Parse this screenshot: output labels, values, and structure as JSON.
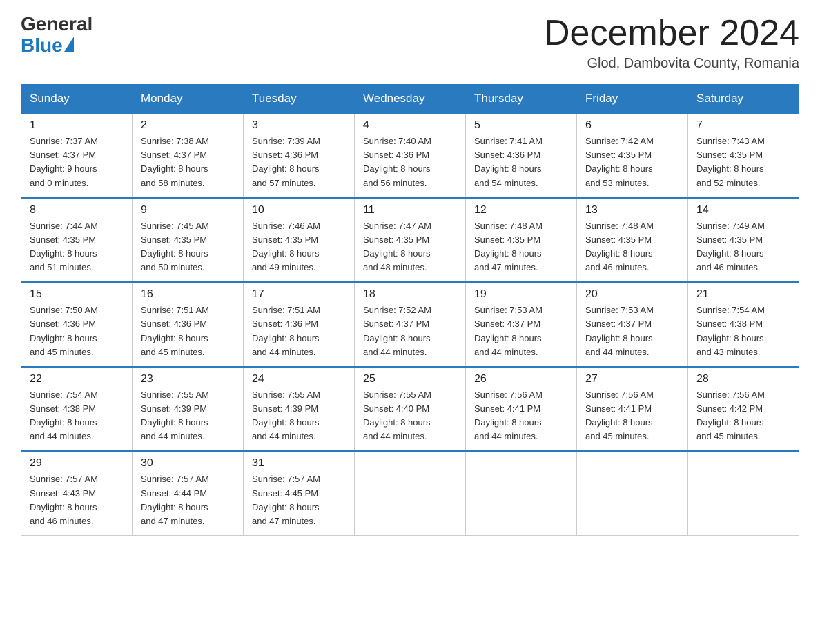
{
  "logo": {
    "general": "General",
    "blue": "Blue"
  },
  "title": "December 2024",
  "location": "Glod, Dambovita County, Romania",
  "days_of_week": [
    "Sunday",
    "Monday",
    "Tuesday",
    "Wednesday",
    "Thursday",
    "Friday",
    "Saturday"
  ],
  "weeks": [
    [
      {
        "day": "1",
        "info": "Sunrise: 7:37 AM\nSunset: 4:37 PM\nDaylight: 9 hours\nand 0 minutes."
      },
      {
        "day": "2",
        "info": "Sunrise: 7:38 AM\nSunset: 4:37 PM\nDaylight: 8 hours\nand 58 minutes."
      },
      {
        "day": "3",
        "info": "Sunrise: 7:39 AM\nSunset: 4:36 PM\nDaylight: 8 hours\nand 57 minutes."
      },
      {
        "day": "4",
        "info": "Sunrise: 7:40 AM\nSunset: 4:36 PM\nDaylight: 8 hours\nand 56 minutes."
      },
      {
        "day": "5",
        "info": "Sunrise: 7:41 AM\nSunset: 4:36 PM\nDaylight: 8 hours\nand 54 minutes."
      },
      {
        "day": "6",
        "info": "Sunrise: 7:42 AM\nSunset: 4:35 PM\nDaylight: 8 hours\nand 53 minutes."
      },
      {
        "day": "7",
        "info": "Sunrise: 7:43 AM\nSunset: 4:35 PM\nDaylight: 8 hours\nand 52 minutes."
      }
    ],
    [
      {
        "day": "8",
        "info": "Sunrise: 7:44 AM\nSunset: 4:35 PM\nDaylight: 8 hours\nand 51 minutes."
      },
      {
        "day": "9",
        "info": "Sunrise: 7:45 AM\nSunset: 4:35 PM\nDaylight: 8 hours\nand 50 minutes."
      },
      {
        "day": "10",
        "info": "Sunrise: 7:46 AM\nSunset: 4:35 PM\nDaylight: 8 hours\nand 49 minutes."
      },
      {
        "day": "11",
        "info": "Sunrise: 7:47 AM\nSunset: 4:35 PM\nDaylight: 8 hours\nand 48 minutes."
      },
      {
        "day": "12",
        "info": "Sunrise: 7:48 AM\nSunset: 4:35 PM\nDaylight: 8 hours\nand 47 minutes."
      },
      {
        "day": "13",
        "info": "Sunrise: 7:48 AM\nSunset: 4:35 PM\nDaylight: 8 hours\nand 46 minutes."
      },
      {
        "day": "14",
        "info": "Sunrise: 7:49 AM\nSunset: 4:35 PM\nDaylight: 8 hours\nand 46 minutes."
      }
    ],
    [
      {
        "day": "15",
        "info": "Sunrise: 7:50 AM\nSunset: 4:36 PM\nDaylight: 8 hours\nand 45 minutes."
      },
      {
        "day": "16",
        "info": "Sunrise: 7:51 AM\nSunset: 4:36 PM\nDaylight: 8 hours\nand 45 minutes."
      },
      {
        "day": "17",
        "info": "Sunrise: 7:51 AM\nSunset: 4:36 PM\nDaylight: 8 hours\nand 44 minutes."
      },
      {
        "day": "18",
        "info": "Sunrise: 7:52 AM\nSunset: 4:37 PM\nDaylight: 8 hours\nand 44 minutes."
      },
      {
        "day": "19",
        "info": "Sunrise: 7:53 AM\nSunset: 4:37 PM\nDaylight: 8 hours\nand 44 minutes."
      },
      {
        "day": "20",
        "info": "Sunrise: 7:53 AM\nSunset: 4:37 PM\nDaylight: 8 hours\nand 44 minutes."
      },
      {
        "day": "21",
        "info": "Sunrise: 7:54 AM\nSunset: 4:38 PM\nDaylight: 8 hours\nand 43 minutes."
      }
    ],
    [
      {
        "day": "22",
        "info": "Sunrise: 7:54 AM\nSunset: 4:38 PM\nDaylight: 8 hours\nand 44 minutes."
      },
      {
        "day": "23",
        "info": "Sunrise: 7:55 AM\nSunset: 4:39 PM\nDaylight: 8 hours\nand 44 minutes."
      },
      {
        "day": "24",
        "info": "Sunrise: 7:55 AM\nSunset: 4:39 PM\nDaylight: 8 hours\nand 44 minutes."
      },
      {
        "day": "25",
        "info": "Sunrise: 7:55 AM\nSunset: 4:40 PM\nDaylight: 8 hours\nand 44 minutes."
      },
      {
        "day": "26",
        "info": "Sunrise: 7:56 AM\nSunset: 4:41 PM\nDaylight: 8 hours\nand 44 minutes."
      },
      {
        "day": "27",
        "info": "Sunrise: 7:56 AM\nSunset: 4:41 PM\nDaylight: 8 hours\nand 45 minutes."
      },
      {
        "day": "28",
        "info": "Sunrise: 7:56 AM\nSunset: 4:42 PM\nDaylight: 8 hours\nand 45 minutes."
      }
    ],
    [
      {
        "day": "29",
        "info": "Sunrise: 7:57 AM\nSunset: 4:43 PM\nDaylight: 8 hours\nand 46 minutes."
      },
      {
        "day": "30",
        "info": "Sunrise: 7:57 AM\nSunset: 4:44 PM\nDaylight: 8 hours\nand 47 minutes."
      },
      {
        "day": "31",
        "info": "Sunrise: 7:57 AM\nSunset: 4:45 PM\nDaylight: 8 hours\nand 47 minutes."
      },
      {
        "day": "",
        "info": ""
      },
      {
        "day": "",
        "info": ""
      },
      {
        "day": "",
        "info": ""
      },
      {
        "day": "",
        "info": ""
      }
    ]
  ]
}
